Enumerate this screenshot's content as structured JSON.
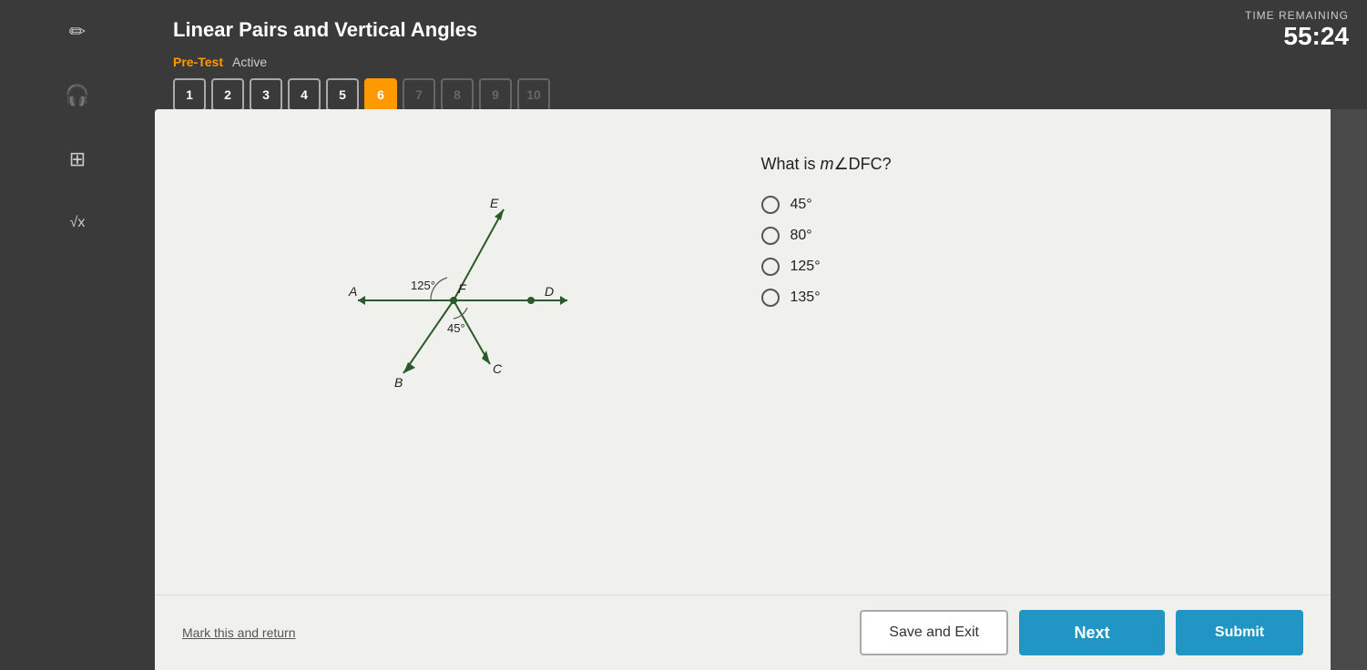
{
  "header": {
    "title": "Linear Pairs and Vertical Angles",
    "pre_test_label": "Pre-Test",
    "active_label": "Active"
  },
  "timer": {
    "label": "TIME REMAINING",
    "value": "55:24"
  },
  "question_nav": {
    "buttons": [
      {
        "number": "1",
        "state": "completed"
      },
      {
        "number": "2",
        "state": "completed"
      },
      {
        "number": "3",
        "state": "completed"
      },
      {
        "number": "4",
        "state": "completed"
      },
      {
        "number": "5",
        "state": "completed"
      },
      {
        "number": "6",
        "state": "active"
      },
      {
        "number": "7",
        "state": "disabled"
      },
      {
        "number": "8",
        "state": "disabled"
      },
      {
        "number": "9",
        "state": "disabled"
      },
      {
        "number": "10",
        "state": "disabled"
      }
    ]
  },
  "question": {
    "text": "What is m∠DFC?",
    "options": [
      {
        "id": "opt1",
        "label": "45°"
      },
      {
        "id": "opt2",
        "label": "80°"
      },
      {
        "id": "opt3",
        "label": "125°"
      },
      {
        "id": "opt4",
        "label": "135°"
      }
    ]
  },
  "diagram": {
    "angle1_label": "125°",
    "angle2_label": "45°",
    "point_a": "A",
    "point_b": "B",
    "point_c": "C",
    "point_d": "D",
    "point_e": "E",
    "point_f": "F"
  },
  "footer": {
    "mark_return_label": "Mark this and return",
    "save_exit_label": "Save and Exit",
    "next_label": "Next",
    "submit_label": "Submit"
  },
  "sidebar": {
    "icons": [
      {
        "name": "pencil-icon",
        "symbol": "✏"
      },
      {
        "name": "headphone-icon",
        "symbol": "🎧"
      },
      {
        "name": "calculator-icon",
        "symbol": "⊞"
      },
      {
        "name": "formula-icon",
        "symbol": "√x"
      }
    ]
  }
}
